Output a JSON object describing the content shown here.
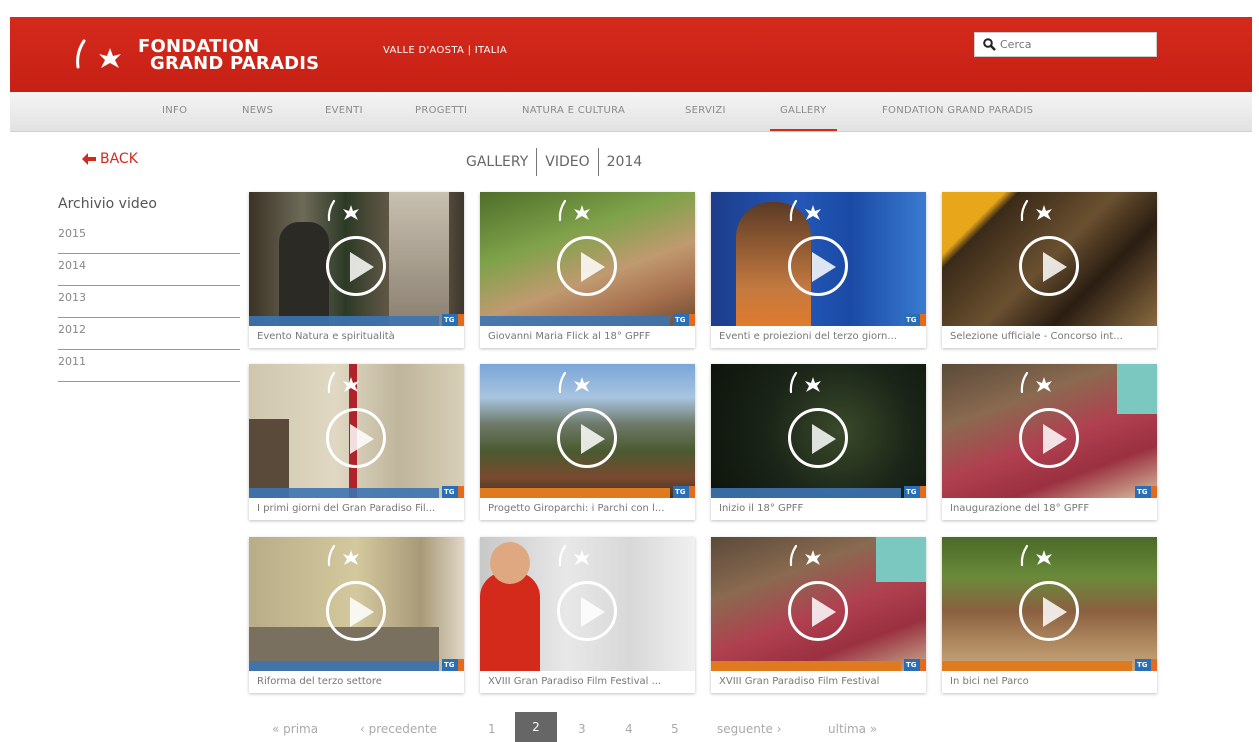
{
  "header": {
    "logo_line1": "FONDATION",
    "logo_line2": "GRAND PARADIS",
    "region": "VALLE D'AOSTA | ITALIA",
    "search_placeholder": "Cerca"
  },
  "nav": {
    "items": [
      "INFO",
      "NEWS",
      "EVENTI",
      "PROGETTI",
      "NATURA E CULTURA",
      "SERVIZI",
      "GALLERY",
      "FONDATION GRAND PARADIS"
    ],
    "active": "GALLERY"
  },
  "back_label": "BACK",
  "breadcrumb": [
    "GALLERY",
    "VIDEO",
    "2014"
  ],
  "sidebar": {
    "title": "Archivio video",
    "years": [
      "2015",
      "2014",
      "2013",
      "2012",
      "2011"
    ]
  },
  "videos": [
    {
      "caption": "Evento Natura e spiritualità"
    },
    {
      "caption": "Giovanni Maria Flick al 18° GPFF"
    },
    {
      "caption": "Eventi e proiezioni del terzo giorn..."
    },
    {
      "caption": "Selezione ufficiale - Concorso int..."
    },
    {
      "caption": "I primi giorni del Gran Paradiso Fil..."
    },
    {
      "caption": "Progetto Giroparchi: i Parchi con l..."
    },
    {
      "caption": "Inizio il 18° GPFF"
    },
    {
      "caption": "Inaugurazione del 18° GPFF"
    },
    {
      "caption": "Riforma del terzo settore"
    },
    {
      "caption": "XVIII Gran Paradiso Film Festival ..."
    },
    {
      "caption": "XVIII Gran Paradiso Film Festival"
    },
    {
      "caption": "In bici nel Parco"
    }
  ],
  "pager": {
    "first": "« prima",
    "prev": "‹ precedente",
    "pages": [
      "1",
      "2",
      "3",
      "4",
      "5"
    ],
    "current": "2",
    "next": "seguente ›",
    "last": "ultima »"
  },
  "colors": {
    "brand_red": "#d42a1c",
    "nav_text": "#8a8a8a"
  }
}
